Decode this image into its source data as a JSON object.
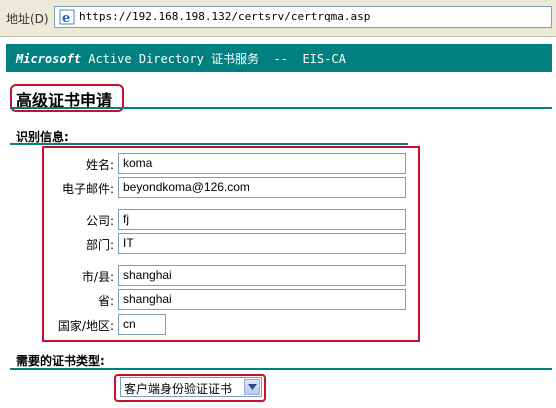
{
  "address_bar": {
    "label": "地址(D)",
    "url": "https://192.168.198.132/certsrv/certrqma.asp"
  },
  "banner": {
    "microsoft": "Microsoft",
    "service": "Active Directory 证书服务",
    "separator": "--",
    "ca_name": "EIS-CA"
  },
  "page_title": "高级证书申请",
  "identity": {
    "section_title": "识别信息:",
    "fields": [
      {
        "label": "姓名:",
        "value": "koma"
      },
      {
        "label": "电子邮件:",
        "value": "beyondkoma@126.com"
      },
      {
        "label": "公司:",
        "value": "fj"
      },
      {
        "label": "部门:",
        "value": "IT"
      },
      {
        "label": "市/县:",
        "value": "shanghai"
      },
      {
        "label": "省:",
        "value": "shanghai"
      },
      {
        "label": "国家/地区:",
        "value": "cn"
      }
    ]
  },
  "cert_type": {
    "section_title": "需要的证书类型:",
    "selected": "客户端身份验证证书"
  },
  "colors": {
    "accent": "#008080",
    "highlight": "#c8102e"
  }
}
